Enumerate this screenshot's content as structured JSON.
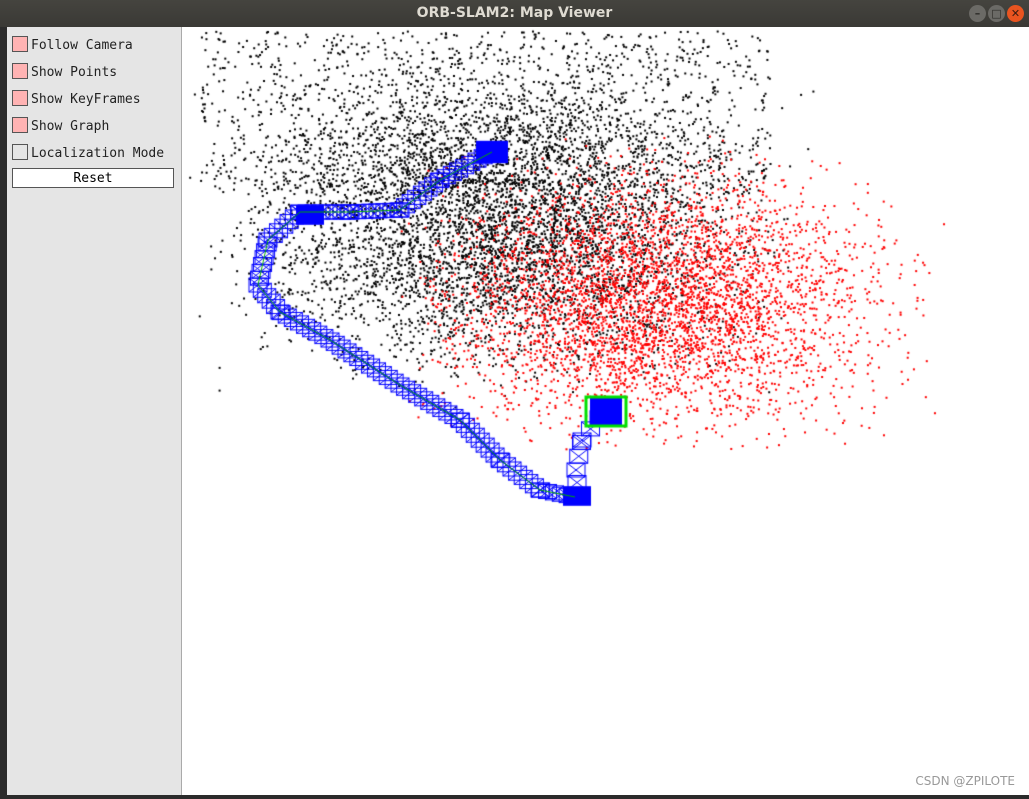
{
  "window": {
    "title": "ORB-SLAM2: Map Viewer",
    "controls": [
      "minimize",
      "maximize",
      "close"
    ],
    "close_color": "#e95420"
  },
  "panel": {
    "checkboxes": [
      {
        "label": "Follow Camera",
        "checked": true
      },
      {
        "label": "Show Points",
        "checked": true
      },
      {
        "label": "Show KeyFrames",
        "checked": true
      },
      {
        "label": "Show Graph",
        "checked": true
      },
      {
        "label": "Localization Mode",
        "checked": false
      }
    ],
    "reset_label": "Reset"
  },
  "viewer": {
    "map_point_color": "#000000",
    "local_map_point_color": "#ff0000",
    "keyframe_color": "#0000ff",
    "current_camera_color": "#00e000",
    "graph_color": "#00aa00"
  },
  "watermark": "CSDN @ZPILOTE"
}
